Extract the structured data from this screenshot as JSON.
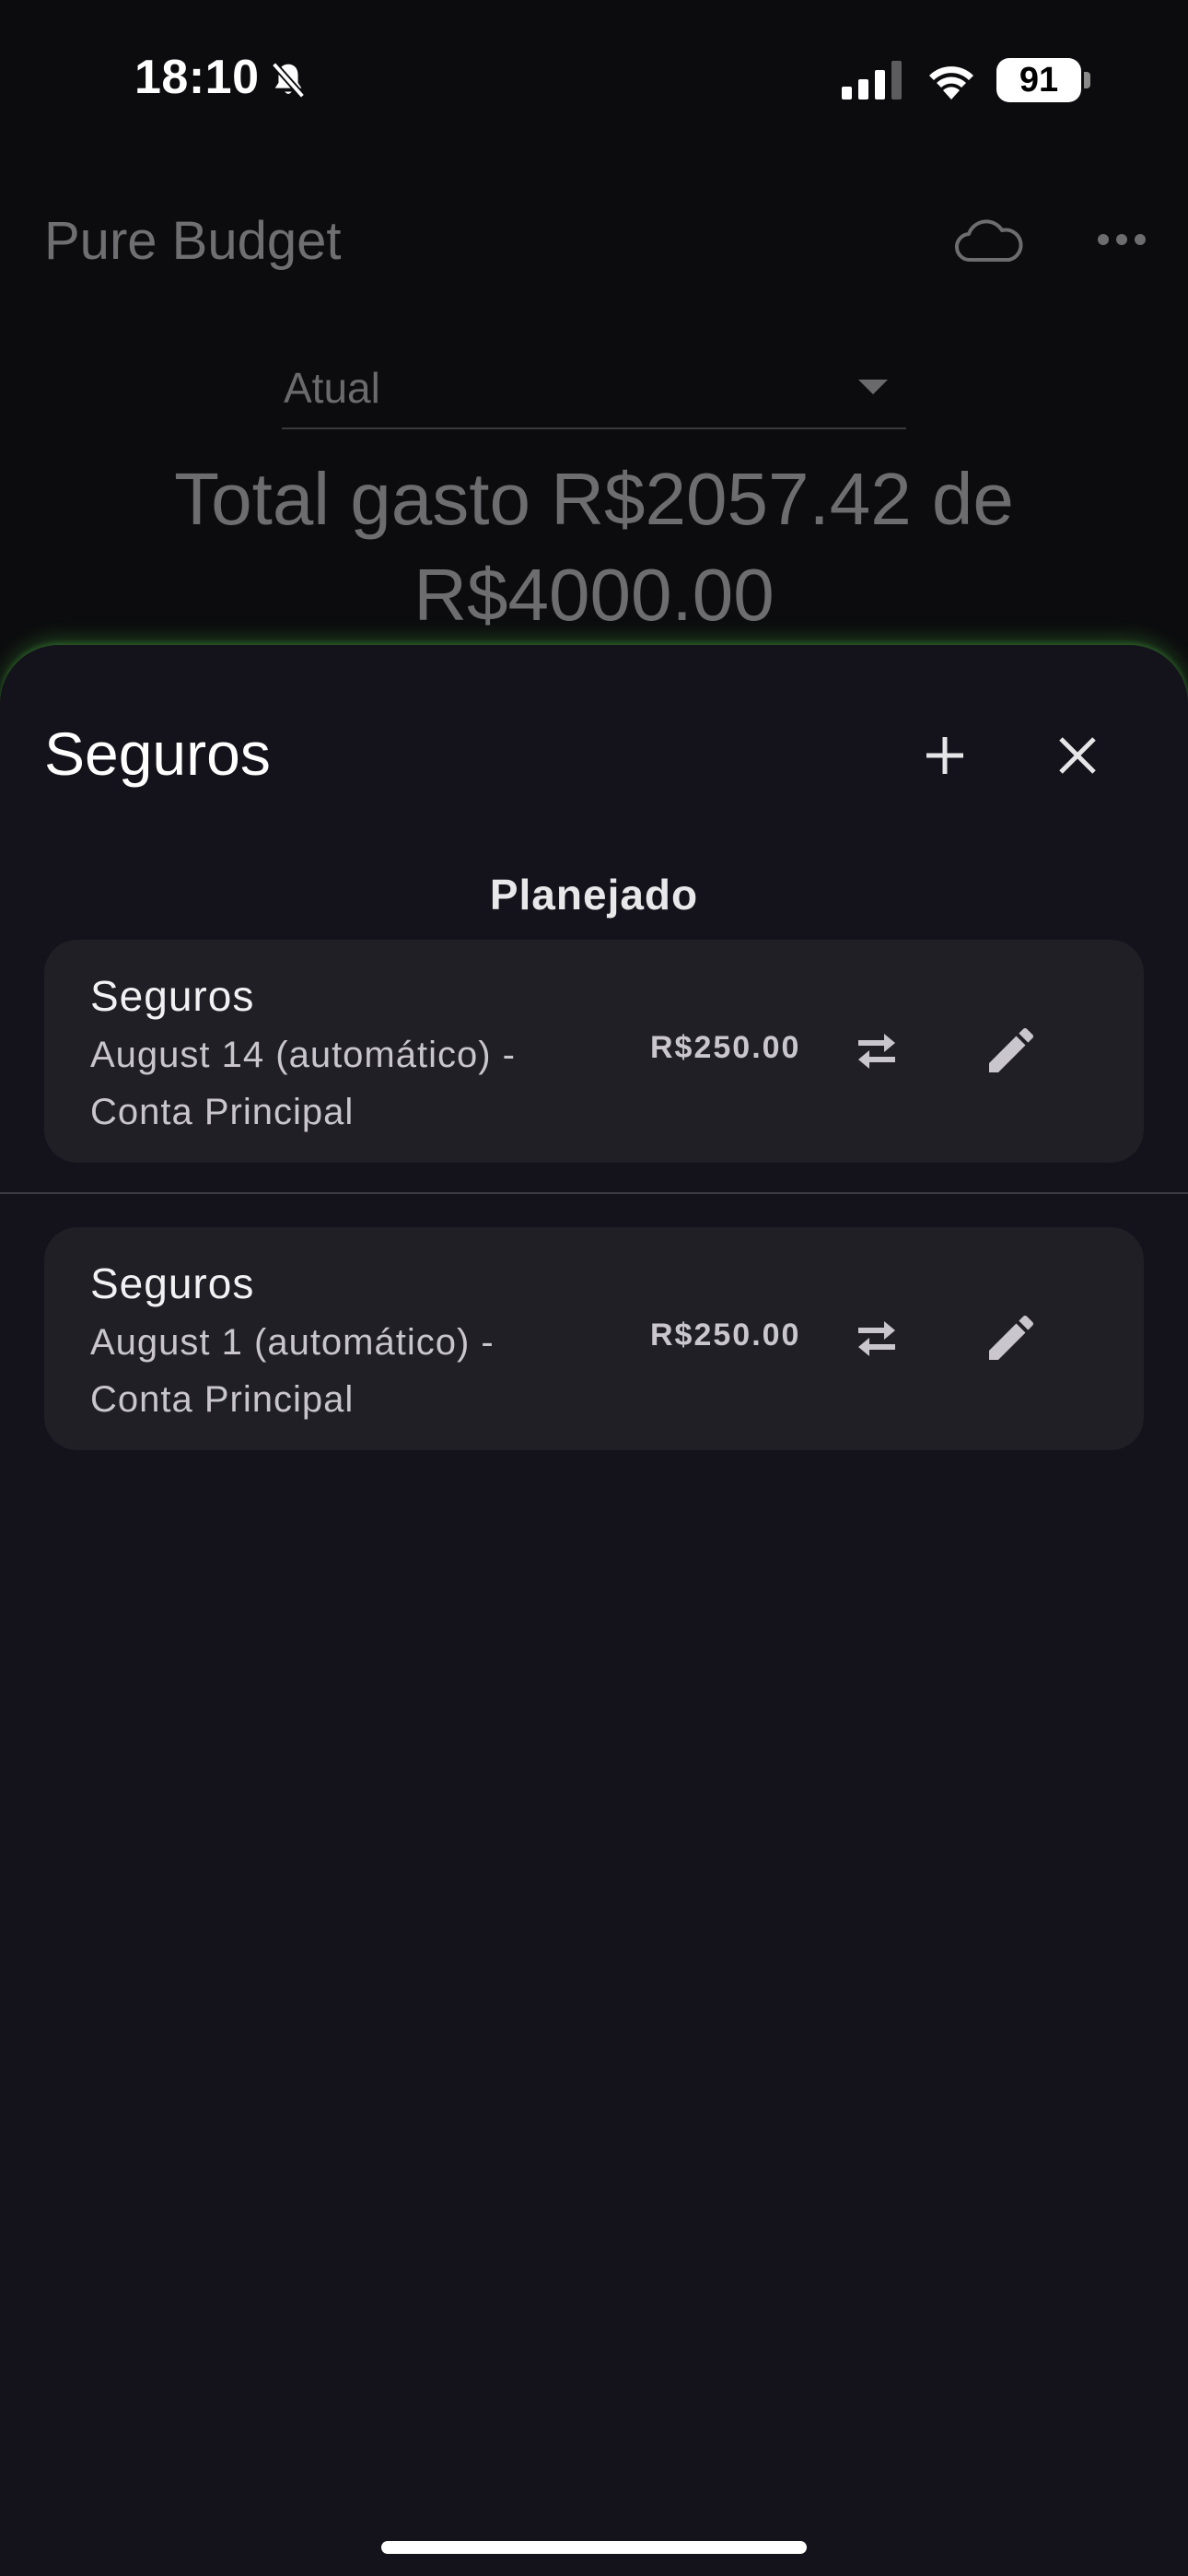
{
  "status_bar": {
    "time": "18:10",
    "battery": "91"
  },
  "app": {
    "title": "Pure Budget",
    "period": "Atual",
    "total_line1": "Total gasto R$2057.42 de",
    "total_line2": "R$4000.00"
  },
  "sheet": {
    "title": "Seguros",
    "section_heading": "Planejado",
    "items": [
      {
        "name": "Seguros",
        "detail_line1": "August 14 (automático) -",
        "detail_line2": "Conta Principal",
        "amount": "R$250.00"
      },
      {
        "name": "Seguros",
        "detail_line1": "August 1 (automático) -",
        "detail_line2": "Conta Principal",
        "amount": "R$250.00"
      }
    ]
  },
  "colors": {
    "sheet_background": "#14121a",
    "card_background": "#211f26",
    "glow": "#5adc50"
  },
  "icons": [
    "bell-slash-icon",
    "cellular-signal-icon",
    "wifi-icon",
    "cloud-icon",
    "more-icon",
    "plus-icon",
    "close-icon",
    "transfer-icon",
    "pencil-icon"
  ]
}
